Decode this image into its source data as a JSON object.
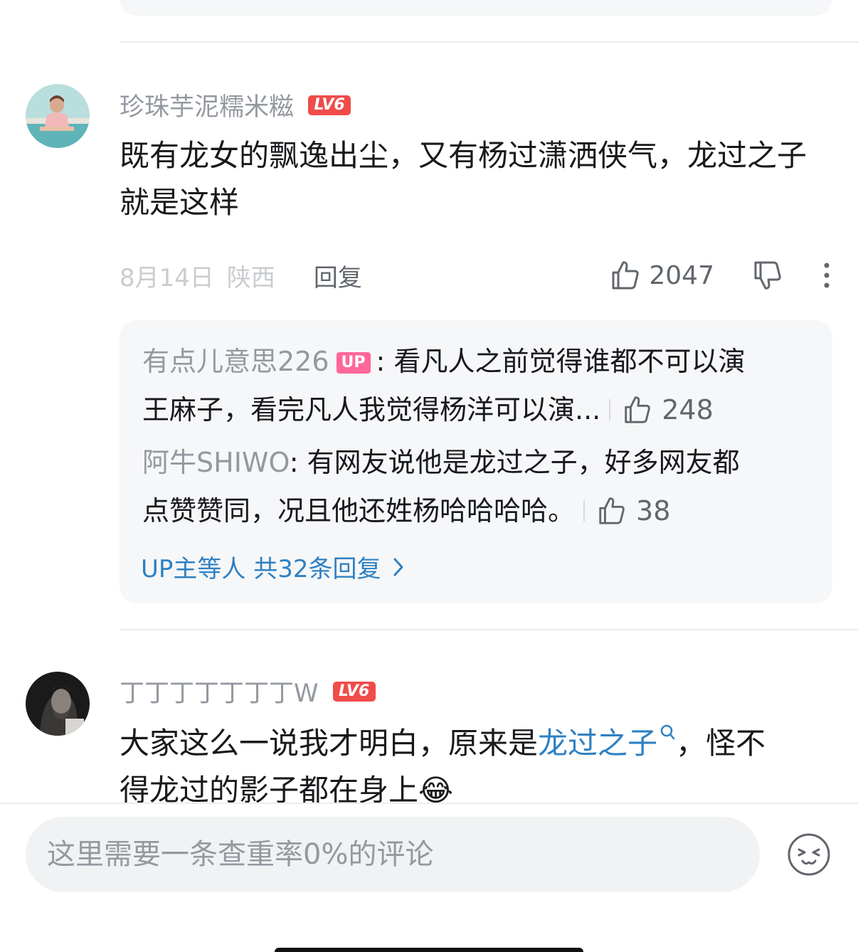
{
  "comments": [
    {
      "username": "珍珠芋泥糯米糍",
      "level": "LV6",
      "content": "既有龙女的飘逸出尘，又有杨过潇洒侠气，龙过之子就是这样",
      "date": "8月14日",
      "location": "陕西",
      "reply_label": "回复",
      "likes": "2047",
      "sub_replies": [
        {
          "name": "有点儿意思226",
          "badge": "UP",
          "text_line1": "看凡人之前觉得谁都不可以演",
          "text_line2": "王麻子，看完凡人我觉得杨洋可以演...",
          "likes": "248"
        },
        {
          "name": "阿牛SHIWO",
          "text_line1": "有网友说他是龙过之子，好多网友都",
          "text_line2": "点赞赞同，况且他还姓杨哈哈哈哈。",
          "likes": "38"
        }
      ],
      "more_replies_label": "UP主等人 共32条回复"
    },
    {
      "username": "丁丁丁丁丁丁丁W",
      "level": "LV6",
      "content_line1_pre": "大家这么一说我才明白，原来是",
      "content_keyword": "龙过之子",
      "content_line1_post": "，怪不",
      "content_line2": "得龙过的影子都在身上",
      "content_emoji": "😂"
    }
  ],
  "input": {
    "placeholder": "这里需要一条查重率0%的评论"
  },
  "icons": [
    "thumb-up-icon",
    "thumb-down-icon",
    "more-vertical-icon",
    "chevron-right-icon",
    "search-mini-icon",
    "emoji-icon"
  ]
}
